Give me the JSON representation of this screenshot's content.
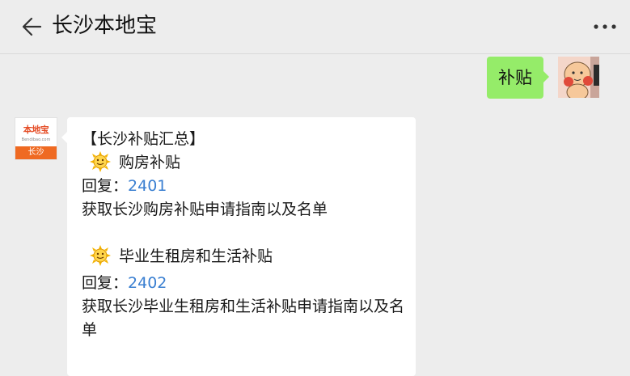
{
  "header": {
    "title": "长沙本地宝"
  },
  "my_message": {
    "text": "补贴"
  },
  "bot": {
    "avatar_logo": "本地宝",
    "avatar_site": "Bendibao.com",
    "avatar_city": "长沙"
  },
  "bot_message": {
    "heading": "【长沙补贴汇总】",
    "sections": [
      {
        "icon": "sun-emoji-icon",
        "title": "购房补贴",
        "reply_label": "回复：",
        "reply_code": "2401",
        "description": "获取长沙购房补贴申请指南以及名单"
      },
      {
        "icon": "sun-emoji-icon",
        "title": "毕业生租房和生活补贴",
        "reply_label": "回复：",
        "reply_code": "2402",
        "description": "获取长沙毕业生租房和生活补贴申请指南以及名单"
      }
    ]
  },
  "colors": {
    "background": "#ededed",
    "my_bubble": "#95ec69",
    "link": "#3a7fd1",
    "logo_orange": "#ef6a22"
  }
}
